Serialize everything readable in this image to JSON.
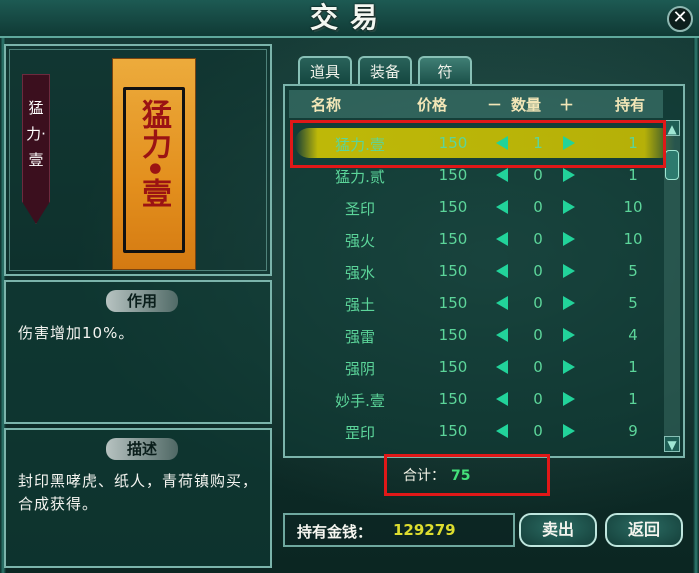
{
  "window": {
    "title": "交易",
    "close_label": "✕"
  },
  "item_preview": {
    "name": "猛力·壹",
    "talisman_text": "猛力•壹"
  },
  "effect": {
    "heading": "作用",
    "text": "伤害增加10%。"
  },
  "description": {
    "heading": "描述",
    "text": "封印黑哮虎、纸人，青荷镇购买，合成获得。"
  },
  "tabs": [
    {
      "label": "道具",
      "active": false
    },
    {
      "label": "装备",
      "active": false
    },
    {
      "label": "符",
      "active": true
    }
  ],
  "table": {
    "headers": {
      "name": "名称",
      "price": "价格",
      "minus": "－",
      "quantity": "数量",
      "plus": "＋",
      "owned": "持有"
    },
    "rows": [
      {
        "name": "猛力.壹",
        "price": "150",
        "qty": "1",
        "owned": "1",
        "selected": true
      },
      {
        "name": "猛力.贰",
        "price": "150",
        "qty": "0",
        "owned": "1"
      },
      {
        "name": "圣印",
        "price": "150",
        "qty": "0",
        "owned": "10"
      },
      {
        "name": "强火",
        "price": "150",
        "qty": "0",
        "owned": "10"
      },
      {
        "name": "强水",
        "price": "150",
        "qty": "0",
        "owned": "5"
      },
      {
        "name": "强土",
        "price": "150",
        "qty": "0",
        "owned": "5"
      },
      {
        "name": "强雷",
        "price": "150",
        "qty": "0",
        "owned": "4"
      },
      {
        "name": "强阴",
        "price": "150",
        "qty": "0",
        "owned": "1"
      },
      {
        "name": "妙手.壹",
        "price": "150",
        "qty": "0",
        "owned": "1"
      },
      {
        "name": "罡印",
        "price": "150",
        "qty": "0",
        "owned": "9"
      }
    ]
  },
  "total": {
    "label": "合计：",
    "value": "75"
  },
  "money": {
    "label": "持有金钱：",
    "value": "129279"
  },
  "buttons": {
    "sell": "卖出",
    "back": "返回"
  },
  "colors": {
    "accent": "#5cd59a",
    "highlight": "#e01818",
    "gold": "#dddd2f"
  }
}
